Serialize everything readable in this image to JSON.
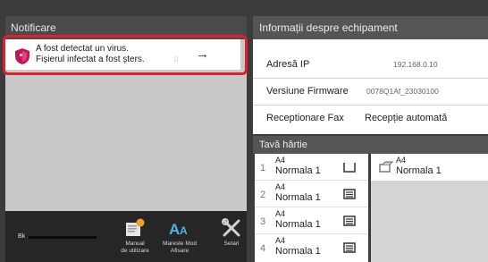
{
  "notification": {
    "header": "Notificare",
    "line1": "A fost detectat un virus.",
    "line2": "Fișierul infectat a fost șters.",
    "faint_text": "0"
  },
  "toolbar": {
    "toner_label": "Bk",
    "manual_label_1": "Manual",
    "manual_label_2": "de utilizare",
    "enlarge_label_1": "Mareste Mod",
    "enlarge_label_2": "Afisare",
    "settings_label": "Setari"
  },
  "equipment_info": {
    "header": "Informații despre echipament",
    "rows": [
      {
        "label": "Adresă IP",
        "value": "192.168.0.10"
      },
      {
        "label": "Versiune Firmware",
        "value": "0078Q1Af_23030100"
      },
      {
        "label": "Receptionare Fax",
        "value": "Recepție automată"
      }
    ]
  },
  "paper_tray": {
    "header": "Tavă hârtie",
    "trays": [
      {
        "number": "1",
        "size": "A4",
        "type": "Normala 1"
      },
      {
        "number": "2",
        "size": "A4",
        "type": "Normala 1"
      },
      {
        "number": "3",
        "size": "A4",
        "type": "Normala 1"
      },
      {
        "number": "4",
        "size": "A4",
        "type": "Normala 1"
      }
    ],
    "bypass": {
      "size": "A4",
      "type": "Normala 1"
    }
  },
  "colors": {
    "highlight": "#e0202b",
    "shield": "#c2185b"
  }
}
